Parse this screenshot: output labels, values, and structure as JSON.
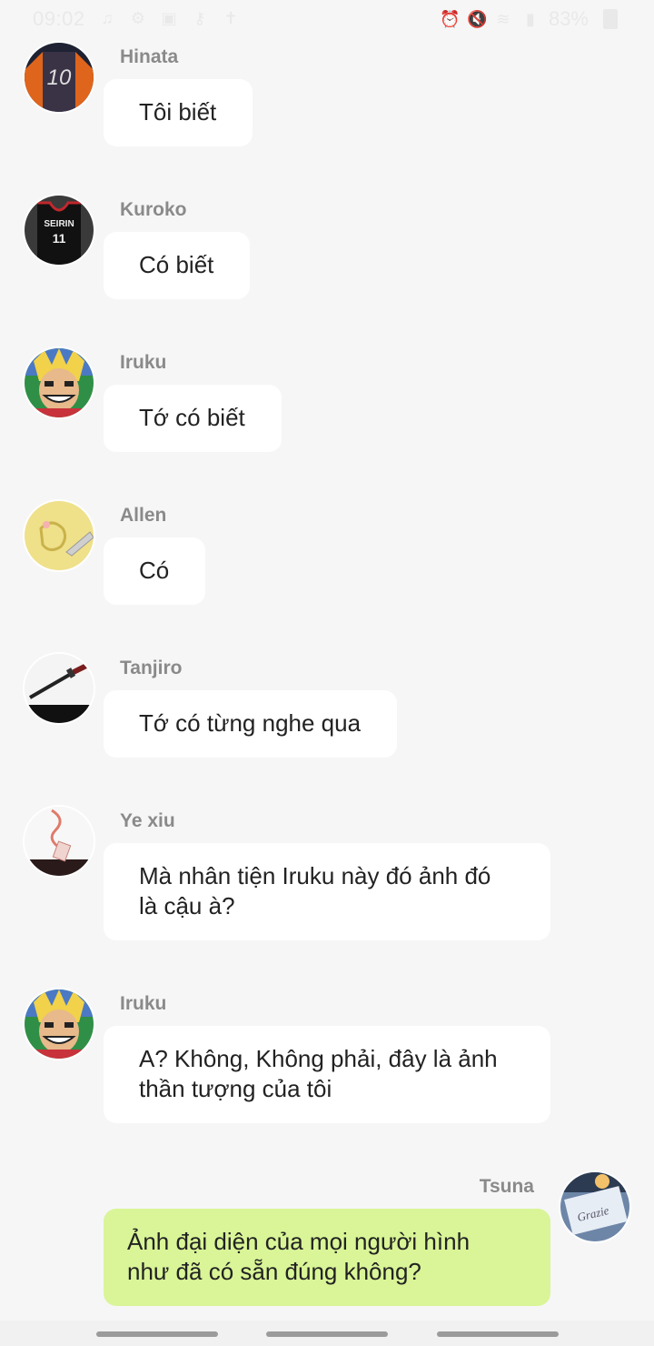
{
  "status_bar": {
    "time": "09:02",
    "battery": "83%",
    "left_icons": [
      "music-icon",
      "settings-photo-icon",
      "image-icon",
      "key-icon",
      "accessibility-icon"
    ],
    "right_icons": [
      "alarm-icon",
      "mute-icon",
      "wifi-off-icon",
      "signal-icon"
    ]
  },
  "messages": [
    {
      "sender": "Hinata",
      "text_lines": [
        "Tôi biết"
      ],
      "avatar": "basketball-jersey-10-avatar"
    },
    {
      "sender": "Kuroko",
      "text_lines": [
        "Có biết"
      ],
      "avatar": "seirin-jersey-11-avatar"
    },
    {
      "sender": "Iruku",
      "text_lines": [
        "Tớ có biết"
      ],
      "avatar": "all-might-avatar"
    },
    {
      "sender": "Allen",
      "text_lines": [
        "Có"
      ],
      "avatar": "yellow-sketch-avatar"
    },
    {
      "sender": "Tanjiro",
      "text_lines": [
        "Tớ có từng nghe qua"
      ],
      "avatar": "katana-avatar"
    },
    {
      "sender": "Ye xiu",
      "text_lines": [
        "Mà nhân tiện Iruku này đó ảnh đó",
        "là cậu à?"
      ],
      "avatar": "red-ribbon-avatar"
    },
    {
      "sender": "Iruku",
      "text_lines": [
        "A? Không, Không phải, đây là ảnh",
        "thần tượng của tôi"
      ],
      "avatar": "all-might-avatar"
    }
  ],
  "self_message": {
    "sender": "Tsuna",
    "text_lines": [
      "Ảnh đại diện của mọi người hình",
      "như đã có sẵn đúng không?"
    ],
    "avatar": "grazie-card-avatar"
  },
  "colors": {
    "background": "#f6f6f6",
    "bubble": "#ffffff",
    "self_bubble": "#d9f597",
    "name": "#8a8a8a"
  }
}
